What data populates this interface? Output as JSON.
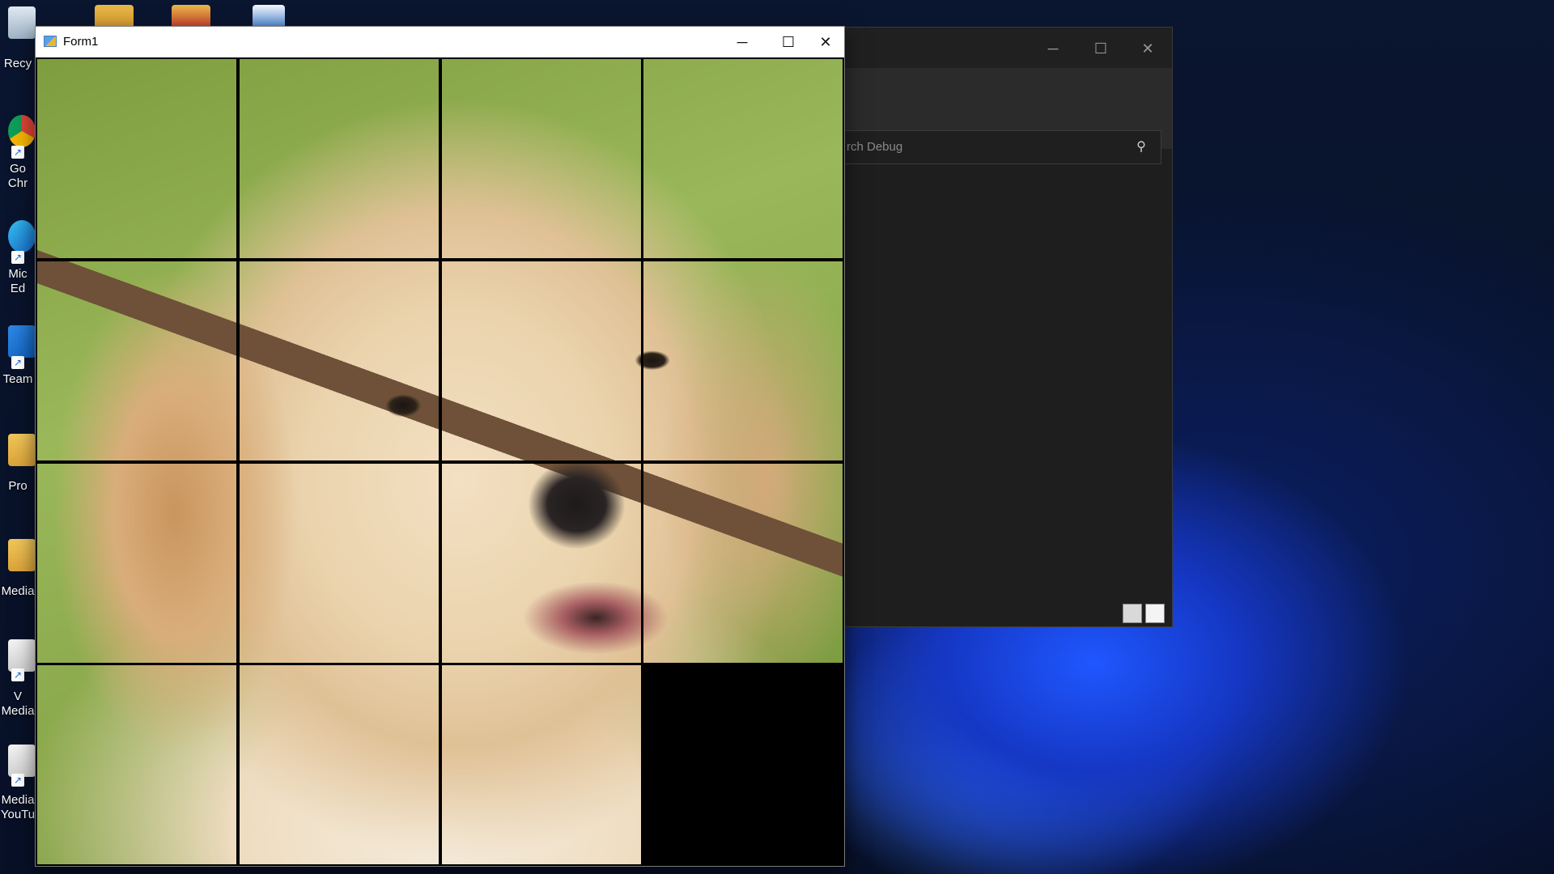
{
  "desktop": {
    "icons": [
      {
        "label": "Recy",
        "icon": "recycle-bin-icon"
      },
      {
        "label": "Go Chr",
        "icon": "chrome-icon"
      },
      {
        "label": "Mic Ed",
        "icon": "edge-icon"
      },
      {
        "label": "Team",
        "icon": "teamviewer-icon"
      },
      {
        "label": "Pro",
        "icon": "folder-icon"
      },
      {
        "label": "Media",
        "icon": "folder-icon"
      },
      {
        "label": "V Media",
        "icon": "shortcut-icon"
      },
      {
        "label": "Media YouTu",
        "icon": "shortcut-icon"
      }
    ]
  },
  "debug_window": {
    "search_placeholder": "rch Debug",
    "minimize": "─",
    "maximize": "☐",
    "close": "✕"
  },
  "form": {
    "title": "Form1",
    "minimize": "─",
    "maximize": "☐",
    "close": "✕"
  },
  "puzzle": {
    "rows": 4,
    "cols": 4,
    "empty_tile": {
      "row": 3,
      "col": 3
    },
    "image": "puppy-with-stick"
  },
  "colors": {
    "desktop_bg": "#081229",
    "debug_bg": "#1e1e1e",
    "board_grid": "#000000"
  }
}
